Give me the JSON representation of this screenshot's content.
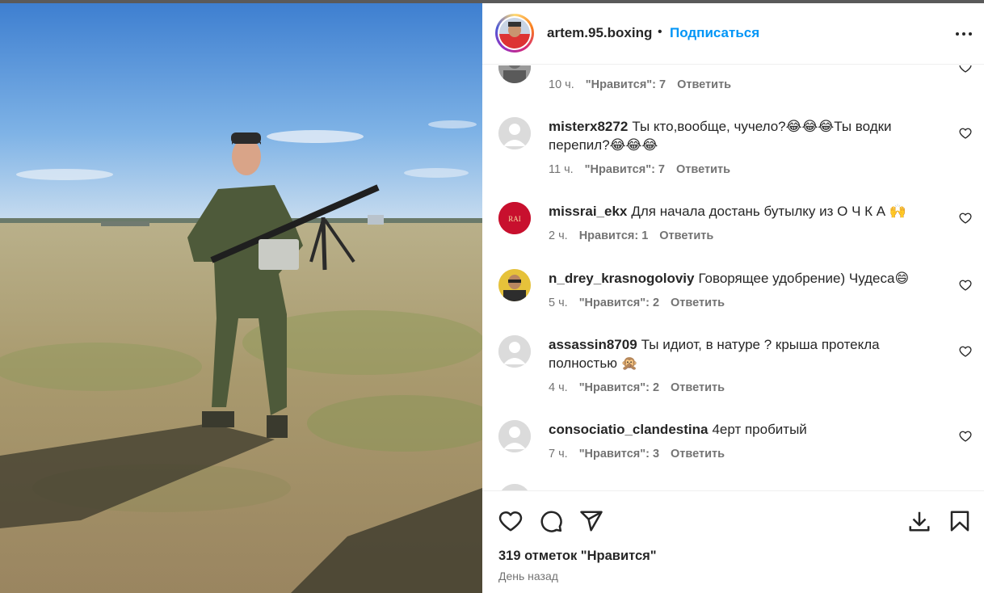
{
  "post": {
    "author": "artem.95.boxing",
    "separator": "•",
    "follow_label": "Подписаться",
    "likes_text": "319 отметок \"Нравится\"",
    "time_ago": "День назад"
  },
  "comments": [
    {
      "user": "",
      "text": "",
      "time": "10 ч.",
      "likes": "\"Нравится\": 7",
      "reply": "Ответить",
      "avatar": "photo-gray"
    },
    {
      "user": "misterx8272",
      "text": "Ты кто,вообще, чучело?😂😂😂Ты водки перепил?😂😂😂",
      "time": "11 ч.",
      "likes": "\"Нравится\": 7",
      "reply": "Ответить",
      "avatar": "default"
    },
    {
      "user": "missrai_ekx",
      "text": "Для начала достань бутылку из О Ч К А 🙌",
      "time": "2 ч.",
      "likes": "Нравится: 1",
      "reply": "Ответить",
      "avatar": "red-logo"
    },
    {
      "user": "n_drey_krasnogoloviy",
      "text": "Говорящее удобрение) Чудеса😄",
      "time": "5 ч.",
      "likes": "\"Нравится\": 2",
      "reply": "Ответить",
      "avatar": "photo-yellow"
    },
    {
      "user": "assassin8709",
      "text": "Ты идиот, в натуре ? крыша протекла полностью 🙊",
      "time": "4 ч.",
      "likes": "\"Нравится\": 2",
      "reply": "Ответить",
      "avatar": "default"
    },
    {
      "user": "consociatio_clandestina",
      "text": "4ерт пробитый",
      "time": "7 ч.",
      "likes": "\"Нравится\": 3",
      "reply": "Ответить",
      "avatar": "default"
    }
  ],
  "icons": {
    "like": "heart-icon",
    "comment": "comment-icon",
    "share": "share-icon",
    "save": "bookmark-icon",
    "download": "download-icon",
    "more": "more-icon"
  },
  "colors": {
    "accent": "#0095f6",
    "text": "#262626",
    "muted": "#737373"
  }
}
